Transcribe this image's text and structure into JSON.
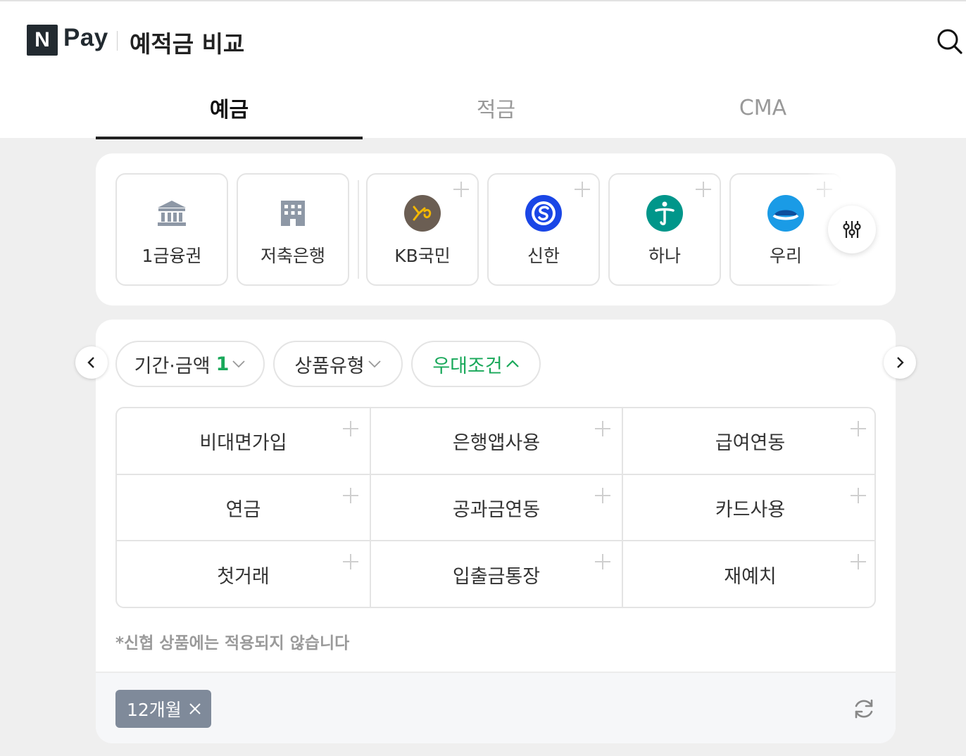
{
  "header": {
    "logo_letter": "N",
    "logo_text": "Pay",
    "title": "예적금 비교",
    "search_icon": "search-icon"
  },
  "tabs": [
    {
      "label": "예금",
      "active": true
    },
    {
      "label": "적금",
      "active": false
    },
    {
      "label": "CMA",
      "active": false
    }
  ],
  "bank_filter": {
    "groups": [
      {
        "label": "1금융권",
        "icon": "bank-building-icon"
      },
      {
        "label": "저축은행",
        "icon": "office-building-icon"
      }
    ],
    "banks": [
      {
        "label": "KB국민",
        "icon": "kb-logo-icon",
        "color": "#6b5e53"
      },
      {
        "label": "신한",
        "icon": "shinhan-logo-icon",
        "color": "#1a46e6"
      },
      {
        "label": "하나",
        "icon": "hana-logo-icon",
        "color": "#00968a"
      },
      {
        "label": "우리",
        "icon": "woori-logo-icon",
        "color": "#1a9be6"
      }
    ],
    "settings_icon": "sliders-icon"
  },
  "filters": {
    "chips": [
      {
        "label": "기간·금액",
        "count": "1",
        "state": "collapsed"
      },
      {
        "label": "상품유형",
        "count": "",
        "state": "collapsed"
      },
      {
        "label": "우대조건",
        "count": "",
        "state": "expanded"
      }
    ],
    "accent_color": "#19a85a"
  },
  "conditions": [
    [
      "비대면가입",
      "은행앱사용",
      "급여연동"
    ],
    [
      "연금",
      "공과금연동",
      "카드사용"
    ],
    [
      "첫거래",
      "입출금통장",
      "재예치"
    ]
  ],
  "note": "*신협 상품에는 적용되지 않습니다",
  "selected": {
    "tags": [
      "12개월"
    ],
    "tag_color": "#7f8a9a"
  }
}
